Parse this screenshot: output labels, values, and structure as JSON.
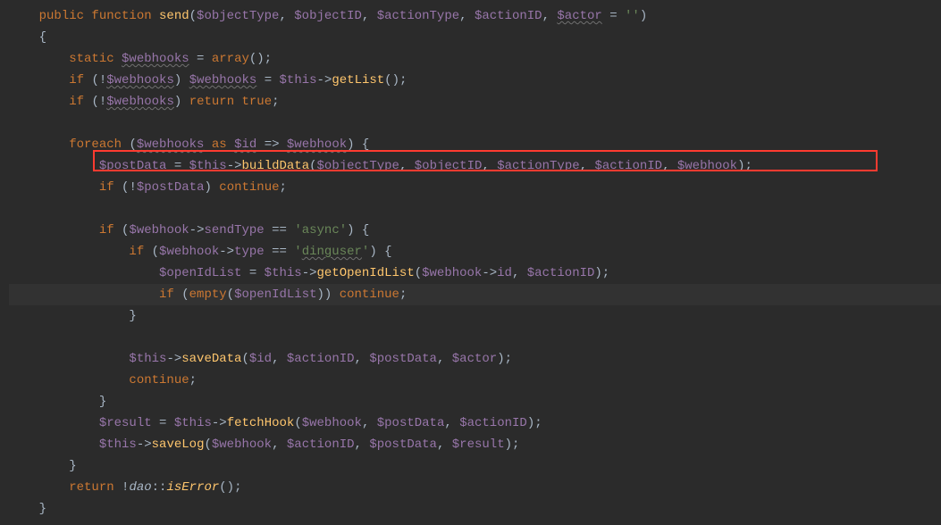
{
  "code": {
    "line1": "    public function send($objectType, $objectID, $actionType, $actionID, $actor = '')",
    "line2": "    {",
    "line3": "        static $webhooks = array();",
    "line4": "        if (!$webhooks) $webhooks = $this->getList();",
    "line5": "        if (!$webhooks) return true;",
    "line6": "",
    "line7": "        foreach ($webhooks as $id => $webhook) {",
    "line8": "            $postData = $this->buildData($objectType, $objectID, $actionType, $actionID, $webhook);",
    "line9": "            if (!$postData) continue;",
    "line10": "",
    "line11": "            if ($webhook->sendType == 'async') {",
    "line12": "                if ($webhook->type == 'dinguser') {",
    "line13": "                    $openIdList = $this->getOpenIdList($webhook->id, $actionID);",
    "line14": "                    if (empty($openIdList)) continue;",
    "line15": "                }",
    "line16": "",
    "line17": "                $this->saveData($id, $actionID, $postData, $actor);",
    "line18": "                continue;",
    "line19": "            }",
    "line20": "            $result = $this->fetchHook($webhook, $postData, $actionID);",
    "line21": "            $this->saveLog($webhook, $actionID, $postData, $result);",
    "line22": "        }",
    "line23": "        return !dao::isError();",
    "line24": "    }"
  },
  "tokens": {
    "keywords": [
      "public",
      "function",
      "static",
      "if",
      "return",
      "true",
      "foreach",
      "as",
      "continue"
    ],
    "functions": [
      "send",
      "getList",
      "buildData",
      "getOpenIdList",
      "saveData",
      "fetchHook",
      "saveLog",
      "isError"
    ],
    "builtins": [
      "array",
      "empty"
    ],
    "variables": [
      "$objectType",
      "$objectID",
      "$actionType",
      "$actionID",
      "$actor",
      "$webhooks",
      "$this",
      "$id",
      "$webhook",
      "$postData",
      "$openIdList",
      "$result"
    ],
    "strings": [
      "''",
      "'async'",
      "'dinguser'"
    ],
    "class": "dao",
    "properties": [
      "sendType",
      "type",
      "id"
    ]
  },
  "highlight_box": {
    "target_line": 8,
    "content": "$postData = $this->buildData($objectType, $objectID, $actionType, $actionID, $webhook);"
  },
  "current_line": 14
}
